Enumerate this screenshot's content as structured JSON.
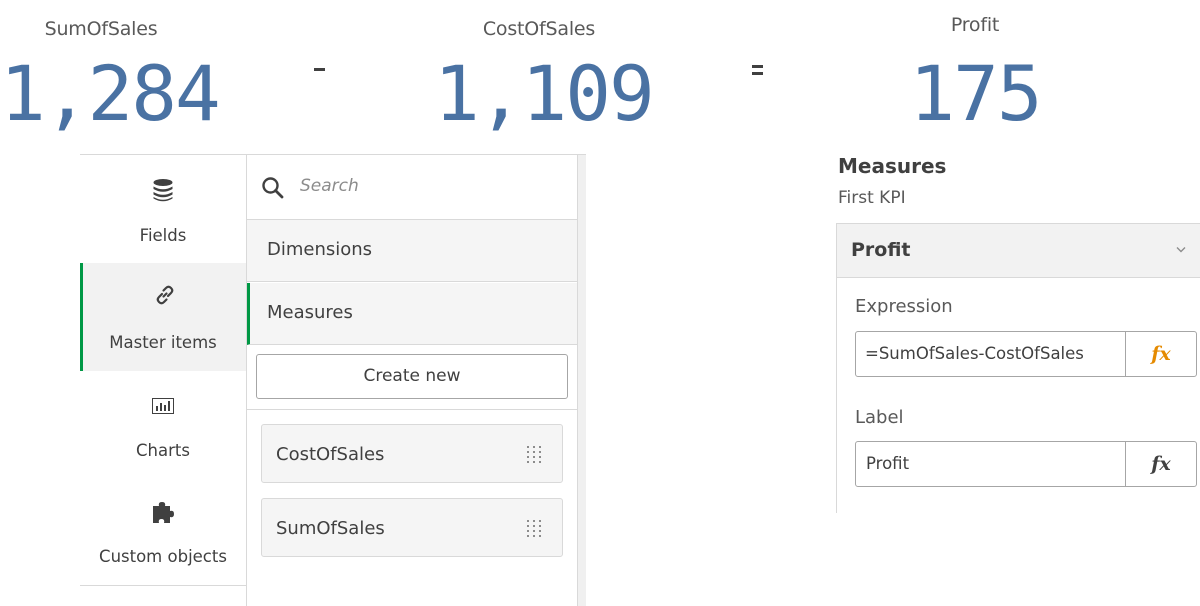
{
  "kpis": [
    {
      "label": "SumOfSales",
      "value": "1,284"
    },
    {
      "label": "CostOfSales",
      "value": "1,109"
    },
    {
      "label": "Profit",
      "value": "175"
    }
  ],
  "operators": {
    "minus": "-",
    "equals": "="
  },
  "assets": {
    "nav": [
      {
        "label": "Fields",
        "icon": "database-icon"
      },
      {
        "label": "Master items",
        "icon": "link-icon",
        "active": true
      },
      {
        "label": "Charts",
        "icon": "bar-chart-icon"
      },
      {
        "label": "Custom objects",
        "icon": "puzzle-icon"
      }
    ],
    "search": {
      "placeholder": "Search"
    },
    "sections": [
      {
        "label": "Dimensions"
      },
      {
        "label": "Measures",
        "active": true
      }
    ],
    "create_new_label": "Create new",
    "measures": [
      {
        "label": "CostOfSales"
      },
      {
        "label": "SumOfSales"
      }
    ]
  },
  "properties": {
    "title": "Measures",
    "subtitle": "First KPI",
    "accordion": {
      "label": "Profit",
      "icon": "chevron-down-icon"
    },
    "expression": {
      "label": "Expression",
      "value": "=SumOfSales-CostOfSales",
      "fx": "fx",
      "fx_color": "#e58a00"
    },
    "label_field": {
      "label": "Label",
      "value": "Profit",
      "fx": "fx",
      "fx_color": "#404040"
    }
  },
  "colors": {
    "kpi_value": "#4a72a3",
    "accent_green": "#009845"
  }
}
